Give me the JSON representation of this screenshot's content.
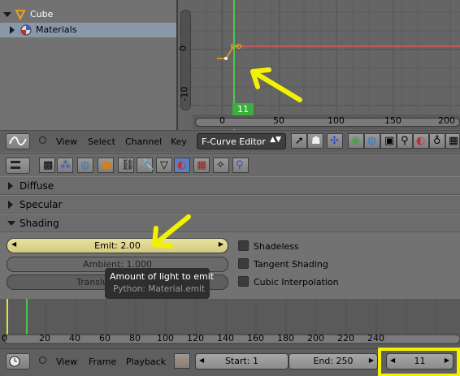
{
  "outliner": {
    "items": [
      {
        "label": "Cube",
        "icon": "object-icon",
        "expanded": true
      },
      {
        "label": "Materials",
        "icon": "material-icon",
        "expanded": false
      }
    ]
  },
  "graph": {
    "y_labels": [
      "0",
      "-10"
    ],
    "x_labels": [
      "0",
      "50",
      "100",
      "150",
      "200"
    ],
    "current_frame": "11",
    "colors": {
      "playhead": "#4fc44f",
      "curve": "#e05a5a",
      "keyframe": "#e8a020",
      "annotation": "#f2f200"
    }
  },
  "graph_header": {
    "menus": [
      "View",
      "Select",
      "Channel",
      "Key"
    ],
    "editor_mode": "F-Curve Editor"
  },
  "panels": {
    "diffuse": "Diffuse",
    "specular": "Specular",
    "shading": "Shading"
  },
  "shading": {
    "emit": "Emit: 2.00",
    "ambient": "Ambient: 1.000",
    "translucency": "Translu",
    "shadeless": "Shadeless",
    "tangent": "Tangent Shading",
    "cubic": "Cubic Interpolation"
  },
  "tooltip": {
    "title": "Amount of light to emit",
    "python": "Python: Material.emit"
  },
  "timeline": {
    "ruler": [
      "0",
      "20",
      "40",
      "60",
      "80",
      "100",
      "120",
      "140",
      "160",
      "180",
      "200",
      "220",
      "240"
    ]
  },
  "timeline_header": {
    "menus": [
      "View",
      "Frame",
      "Playback"
    ],
    "start": "Start: 1",
    "end": "End: 250",
    "current": "11"
  }
}
